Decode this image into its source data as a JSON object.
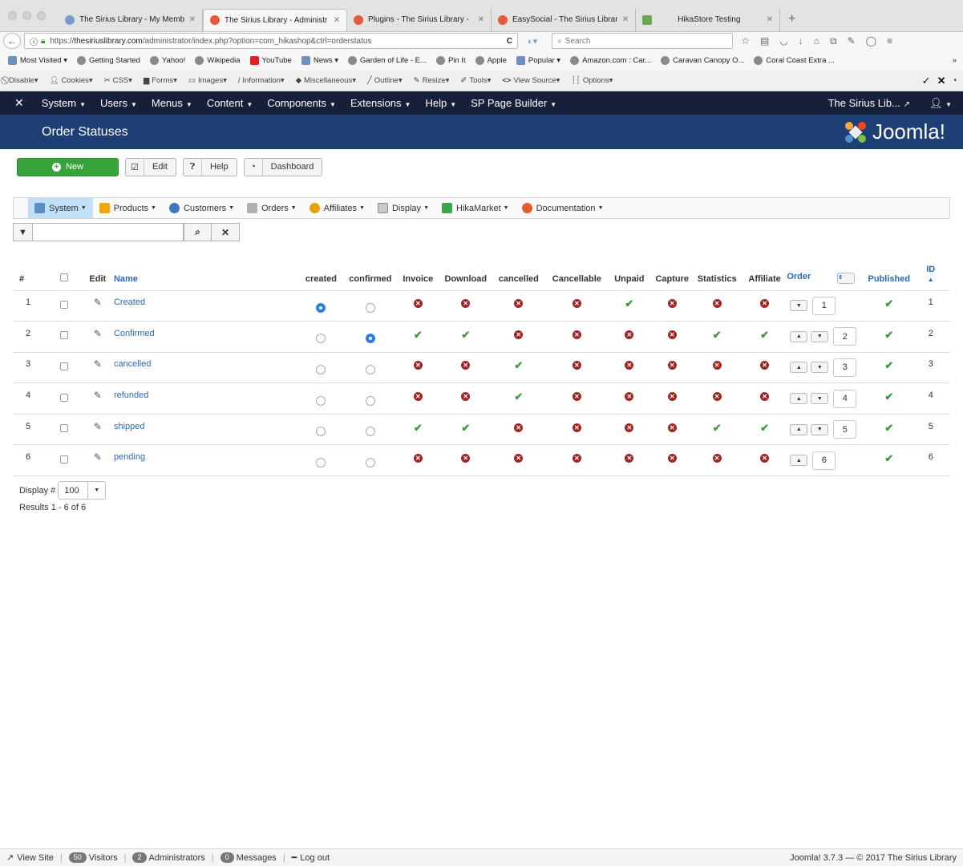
{
  "browser": {
    "tabs": [
      {
        "title": "The Sirius Library - My Memb",
        "active": false
      },
      {
        "title": "The Sirius Library - Administr",
        "active": true
      },
      {
        "title": "Plugins - The Sirius Library -",
        "active": false
      },
      {
        "title": "EasySocial - The Sirius Librar",
        "active": false
      },
      {
        "title": "HikaStore Testing",
        "active": false
      }
    ],
    "url_prefix": "https://",
    "url_host": "thesiriuslibrary.com",
    "url_path": "/administrator/index.php?option=com_hikashop&ctrl=orderstatus",
    "search_placeholder": "Search",
    "bookmarks": [
      "Most Visited",
      "Getting Started",
      "Yahoo!",
      "Wikipedia",
      "YouTube",
      "News",
      "Garden of Life - E...",
      "Pin It",
      "Apple",
      "Popular",
      "Amazon.com : Car...",
      "Caravan Canopy O...",
      "Coral Coast Extra ..."
    ],
    "devtools": [
      "Disable",
      "Cookies",
      "CSS",
      "Forms",
      "Images",
      "Information",
      "Miscellaneous",
      "Outline",
      "Resize",
      "Tools",
      "View Source",
      "Options"
    ]
  },
  "admin_nav": {
    "items": [
      "System",
      "Users",
      "Menus",
      "Content",
      "Components",
      "Extensions",
      "Help",
      "SP Page Builder"
    ],
    "site_name": "The Sirius Lib..."
  },
  "header": {
    "title": "Order Statuses",
    "brand": "Joomla!"
  },
  "toolbar": {
    "new": "New",
    "edit": "Edit",
    "help": "Help",
    "dashboard": "Dashboard"
  },
  "hika_menu": [
    "System",
    "Products",
    "Customers",
    "Orders",
    "Affiliates",
    "Display",
    "HikaMarket",
    "Documentation"
  ],
  "table": {
    "headers": {
      "num": "#",
      "edit": "Edit",
      "name": "Name",
      "created": "created",
      "confirmed": "confirmed",
      "invoice": "Invoice",
      "download": "Download",
      "cancelled": "cancelled",
      "cancellable": "Cancellable",
      "unpaid": "Unpaid",
      "capture": "Capture",
      "statistics": "Statistics",
      "affiliate": "Affiliate",
      "order": "Order",
      "published": "Published",
      "id": "ID"
    },
    "rows": [
      {
        "num": "1",
        "name": "Created",
        "created": true,
        "confirmed": false,
        "flags": [
          false,
          false,
          false,
          false,
          true,
          false,
          false,
          false
        ],
        "order": "1",
        "up": false,
        "down": true,
        "published": true,
        "id": "1"
      },
      {
        "num": "2",
        "name": "Confirmed",
        "created": false,
        "confirmed": true,
        "flags": [
          true,
          true,
          false,
          false,
          false,
          false,
          true,
          true
        ],
        "order": "2",
        "up": true,
        "down": true,
        "published": true,
        "id": "2"
      },
      {
        "num": "3",
        "name": "cancelled",
        "created": false,
        "confirmed": false,
        "flags": [
          false,
          false,
          true,
          false,
          false,
          false,
          false,
          false
        ],
        "order": "3",
        "up": true,
        "down": true,
        "published": true,
        "id": "3"
      },
      {
        "num": "4",
        "name": "refunded",
        "created": false,
        "confirmed": false,
        "flags": [
          false,
          false,
          true,
          false,
          false,
          false,
          false,
          false
        ],
        "order": "4",
        "up": true,
        "down": true,
        "published": true,
        "id": "4"
      },
      {
        "num": "5",
        "name": "shipped",
        "created": false,
        "confirmed": false,
        "flags": [
          true,
          true,
          false,
          false,
          false,
          false,
          true,
          true
        ],
        "order": "5",
        "up": true,
        "down": true,
        "published": true,
        "id": "5"
      },
      {
        "num": "6",
        "name": "pending",
        "created": false,
        "confirmed": false,
        "flags": [
          false,
          false,
          false,
          false,
          false,
          false,
          false,
          false
        ],
        "order": "6",
        "up": true,
        "down": false,
        "published": true,
        "id": "6"
      }
    ]
  },
  "pagination": {
    "display_label": "Display #",
    "display_value": "100",
    "results": "Results 1 - 6 of 6"
  },
  "statusbar": {
    "view_site": "View Site",
    "visitors_count": "50",
    "visitors_label": "Visitors",
    "admins_count": "2",
    "admins_label": "Administrators",
    "messages_count": "0",
    "messages_label": "Messages",
    "logout": "Log out",
    "footer": "Joomla! 3.7.3  —  © 2017 The Sirius Library"
  }
}
